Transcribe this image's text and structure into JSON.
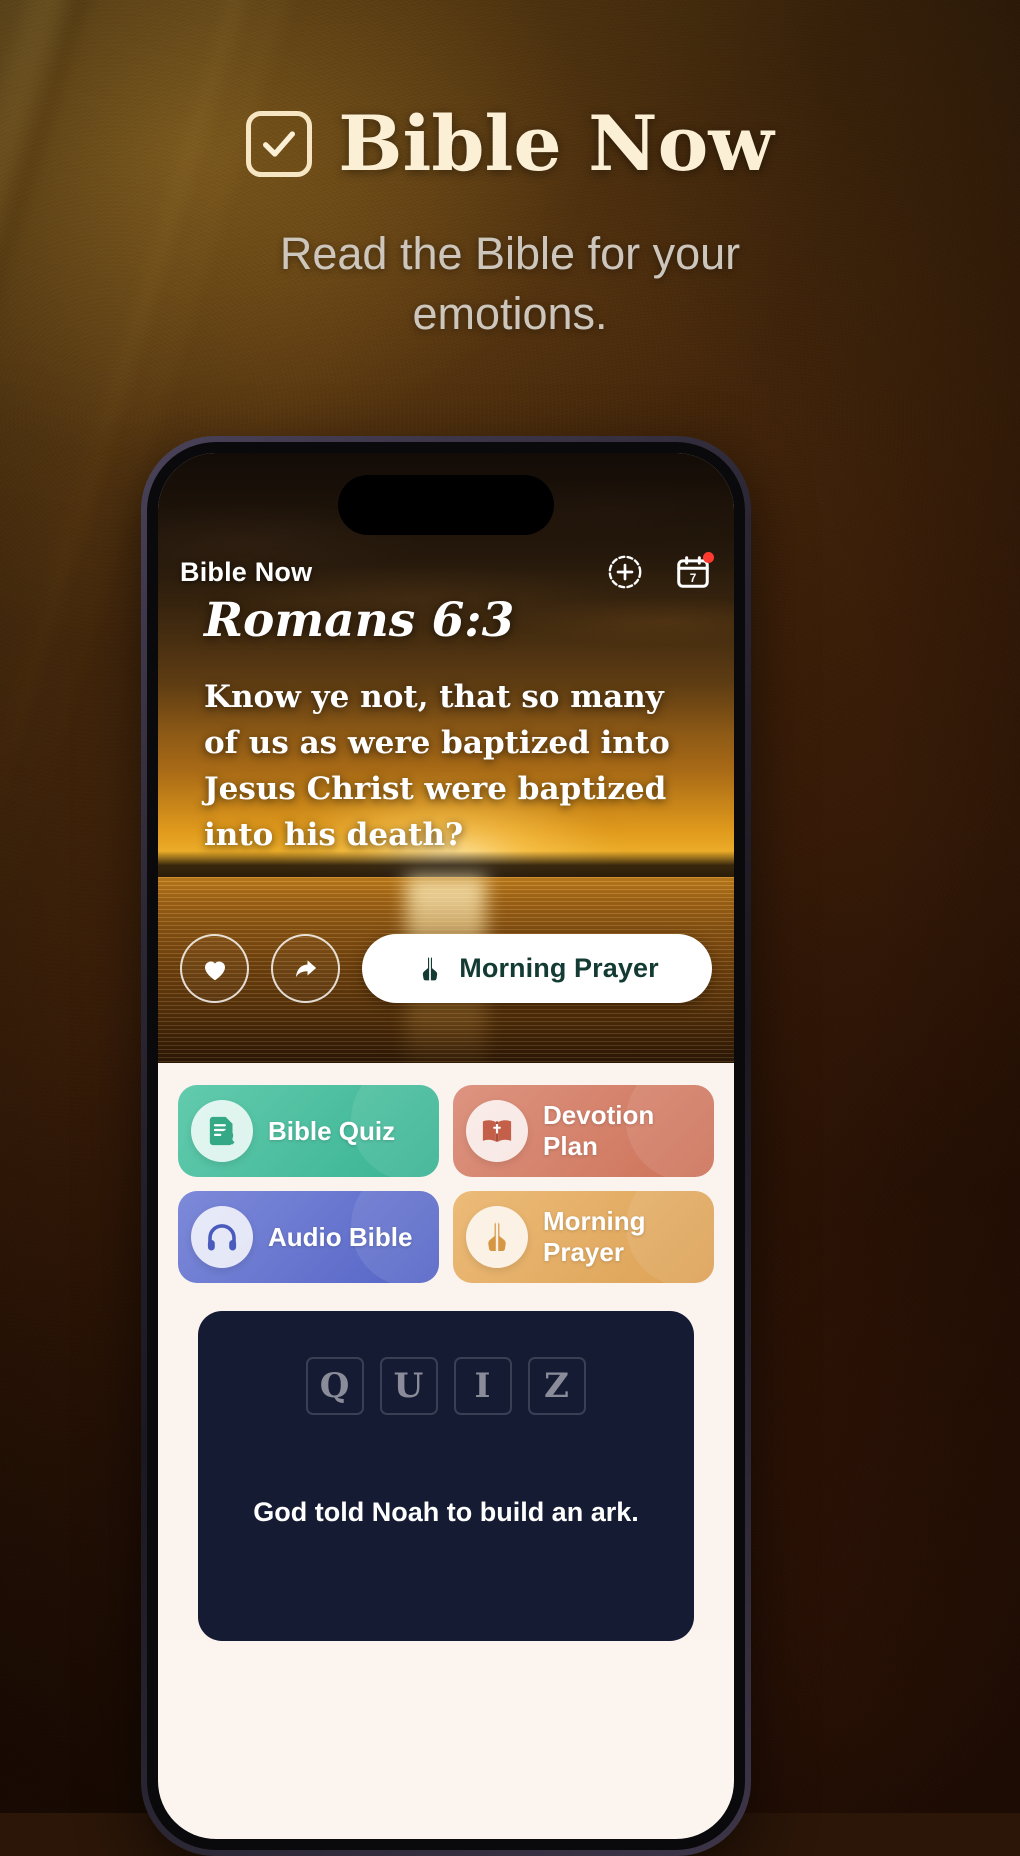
{
  "hero": {
    "logo_icon": "checkbox-check-icon",
    "title": "Bible Now",
    "subtitle": "Read the Bible for your emotions."
  },
  "phone": {
    "appbar": {
      "app_name": "Bible Now",
      "icons": [
        {
          "name": "add-circle-icon",
          "label": "Add"
        },
        {
          "name": "calendar-icon",
          "label": "Calendar",
          "badge": true,
          "day": "7"
        }
      ]
    },
    "verse": {
      "reference": "Romans 6:3",
      "text": "Know ye not, that so many of us as were baptized into Jesus Christ were baptized into his death?"
    },
    "actions": {
      "favorite_icon": "heart-icon",
      "share_icon": "share-icon",
      "prayer_icon": "praying-hands-icon",
      "prayer_label": "Morning Prayer"
    },
    "features": [
      {
        "label": "Bible Quiz",
        "icon": "quiz-document-icon",
        "color": "#4fc0a0"
      },
      {
        "label": "Devotion Plan",
        "icon": "open-bible-icon",
        "color": "#d4836c"
      },
      {
        "label": "Audio Bible",
        "icon": "headphones-icon",
        "color": "#6878d0"
      },
      {
        "label": "Morning Prayer",
        "icon": "praying-hands-icon",
        "color": "#e0ac63"
      }
    ],
    "quiz": {
      "letters": [
        "Q",
        "U",
        "I",
        "Z"
      ],
      "question": "God told Noah to build an ark."
    }
  },
  "colors": {
    "hero_title": "#fbefd5",
    "hero_subtitle": "#cdc6bd",
    "prayer_text": "#133b33",
    "quiz_panel_bg": "#151b33",
    "sheet_bg": "#fbf3ee",
    "badge": "#ff3b30"
  }
}
